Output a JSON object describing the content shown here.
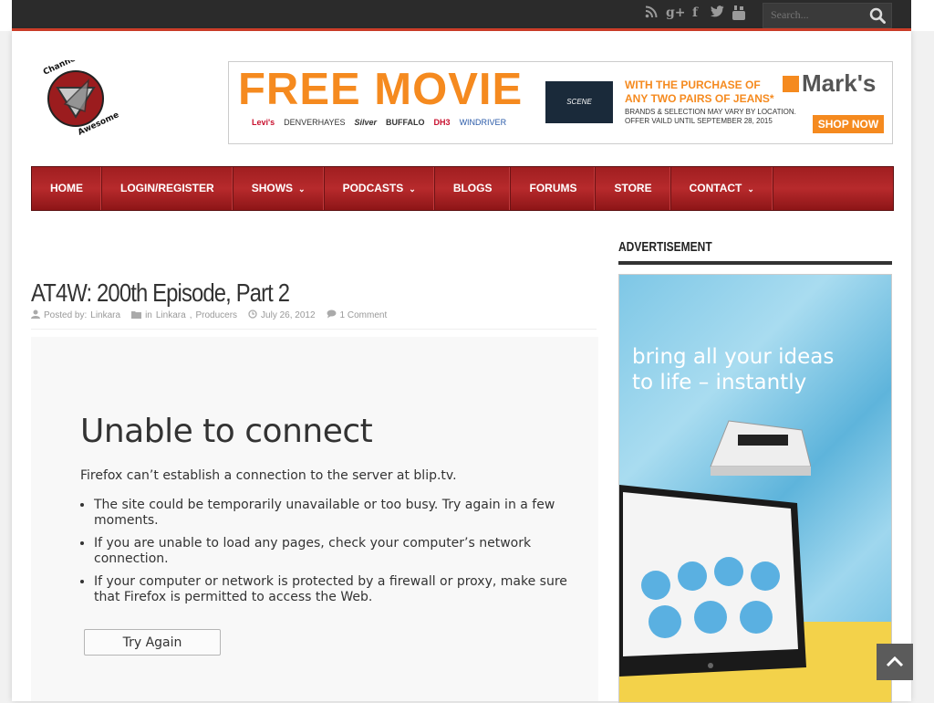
{
  "header": {
    "social_icons": [
      "rss-icon",
      "google-plus-icon",
      "facebook-icon",
      "twitter-icon",
      "youtube-icon"
    ],
    "search": {
      "placeholder": "Search..."
    }
  },
  "logo": {
    "line1": "Channel",
    "line2": "Awesome"
  },
  "banner_ad": {
    "headline": "FREE MOVIE",
    "brands": [
      "Levi's",
      "DENVERHAYES",
      "Silver",
      "BUFFALO",
      "DH3",
      "WINDRIVER"
    ],
    "scene_label": "SCENE",
    "purchase_line1": "WITH THE PURCHASE OF",
    "purchase_line2": "ANY TWO PAIRS OF JEANS*",
    "fine_print_line1": "BRANDS & SELECTION MAY VARY BY LOCATION.",
    "fine_print_line2": "OFFER VAILD UNTIL SEPTEMBER 28, 2015",
    "store_name": "Mark's",
    "cta": "SHOP NOW"
  },
  "nav": {
    "items": [
      {
        "label": "HOME",
        "has_dropdown": false
      },
      {
        "label": "LOGIN/REGISTER",
        "has_dropdown": false
      },
      {
        "label": "SHOWS",
        "has_dropdown": true
      },
      {
        "label": "PODCASTS",
        "has_dropdown": true
      },
      {
        "label": "BLOGS",
        "has_dropdown": false
      },
      {
        "label": "FORUMS",
        "has_dropdown": false
      },
      {
        "label": "STORE",
        "has_dropdown": false
      },
      {
        "label": "CONTACT",
        "has_dropdown": true
      }
    ]
  },
  "post": {
    "title": "AT4W: 200th Episode, Part 2",
    "posted_by_prefix": "Posted by:",
    "author": "Linkara",
    "in_prefix": "in",
    "category1": "Linkara",
    "category2": "Producers",
    "date": "July 26, 2012",
    "comments": "1 Comment"
  },
  "error": {
    "title": "Unable to connect",
    "description": "Firefox can’t establish a connection to the server at blip.tv.",
    "bullets": [
      "The site could be temporarily unavailable or too busy. Try again in a few moments.",
      "If you are unable to load any pages, check your computer’s network connection.",
      "If your computer or network is protected by a firewall or proxy, make sure that Firefox is permitted to access the Web."
    ],
    "button": "Try Again"
  },
  "sidebar": {
    "heading": "ADVERTISEMENT",
    "ad_text_line1": "bring all your ideas",
    "ad_text_line2": "to life – instantly"
  },
  "colors": {
    "nav_red": "#a01e20",
    "accent_orange": "#f58a1f",
    "topbar_dark": "#2b2b2b"
  }
}
